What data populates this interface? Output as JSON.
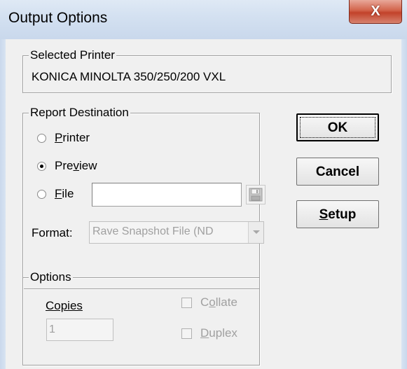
{
  "window": {
    "title": "Output Options",
    "close_glyph": "X"
  },
  "selected_printer": {
    "label": "Selected Printer",
    "value": "KONICA MINOLTA 350/250/200 VXL"
  },
  "report_destination": {
    "label": "Report Destination",
    "options": [
      {
        "label_pre": "",
        "label_key": "P",
        "label_post": "rinter",
        "checked": false
      },
      {
        "label_pre": "Pre",
        "label_key": "v",
        "label_post": "iew",
        "checked": true
      },
      {
        "label_pre": "",
        "label_key": "F",
        "label_post": "ile",
        "checked": false
      }
    ],
    "file_value": "",
    "format_label": "Format:",
    "format_value": "Rave Snapshot File (ND"
  },
  "options_group": {
    "label": "Options",
    "copies_label": "Copies",
    "copies_value": "1",
    "collate_pre": "C",
    "collate_key": "o",
    "collate_post": "llate",
    "duplex_pre": "",
    "duplex_key": "D",
    "duplex_post": "uplex"
  },
  "buttons": {
    "ok": "OK",
    "cancel": "Cancel",
    "setup_key": "S",
    "setup_rest": "etup"
  },
  "icons": {
    "close": "close-icon",
    "save": "floppy-disk-icon",
    "dropdown": "chevron-down-icon"
  },
  "colors": {
    "close_button": "#c2422a",
    "disabled_text": "#a0a0a0"
  }
}
